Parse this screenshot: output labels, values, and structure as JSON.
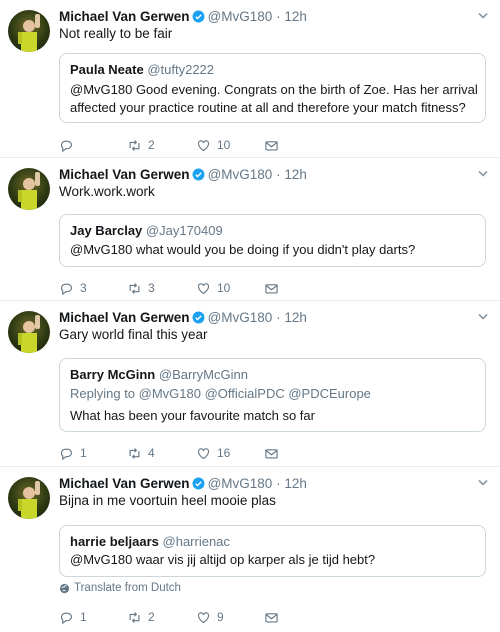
{
  "colors": {
    "accent": "#1da1f2",
    "text": "#14171a",
    "muted": "#657786",
    "border": "#e6ecf0"
  },
  "tweets": [
    {
      "author": "Michael Van Gerwen",
      "handle": "@MvG180",
      "sep": "·",
      "time": "12h",
      "text": "Not really to be fair",
      "quote": {
        "author": "Paula Neate",
        "handle": "@tufty2222",
        "lines": [
          "@MvG180 Good evening. Congrats on the birth of Zoe.  Has her arrival",
          "affected your practice routine at all and therefore your match fitness?"
        ]
      },
      "replies": "",
      "retweets": "2",
      "likes": "10"
    },
    {
      "author": "Michael Van Gerwen",
      "handle": "@MvG180",
      "sep": "·",
      "time": "12h",
      "text": "Work.work.work",
      "quote": {
        "author": "Jay Barclay",
        "handle": "@Jay170409",
        "lines": [
          "@MvG180 what would you be doing if you didn't play darts?"
        ]
      },
      "replies": "3",
      "retweets": "3",
      "likes": "10"
    },
    {
      "author": "Michael Van Gerwen",
      "handle": "@MvG180",
      "sep": "·",
      "time": "12h",
      "text": "Gary world final this year",
      "quote": {
        "author": "Barry McGinn",
        "handle": "@BarryMcGinn",
        "replying_to": "Replying to @MvG180 @OfficialPDC @PDCEurope",
        "lines": [
          "What has been your favourite match so far"
        ]
      },
      "replies": "1",
      "retweets": "4",
      "likes": "16"
    },
    {
      "author": "Michael Van Gerwen",
      "handle": "@MvG180",
      "sep": "·",
      "time": "12h",
      "text": "Bijna in me voortuin heel mooie plas",
      "quote": {
        "author": "harrie beljaars",
        "handle": "@harrienac",
        "lines": [
          "@MvG180 waar vis jij altijd op karper als je tijd hebt?"
        ]
      },
      "translate": "Translate from Dutch",
      "replies": "1",
      "retweets": "2",
      "likes": "9"
    }
  ],
  "icons": [
    "reply-icon",
    "retweet-icon",
    "like-icon",
    "message-icon",
    "verified-badge-icon",
    "caret-down-icon",
    "globe-icon"
  ]
}
